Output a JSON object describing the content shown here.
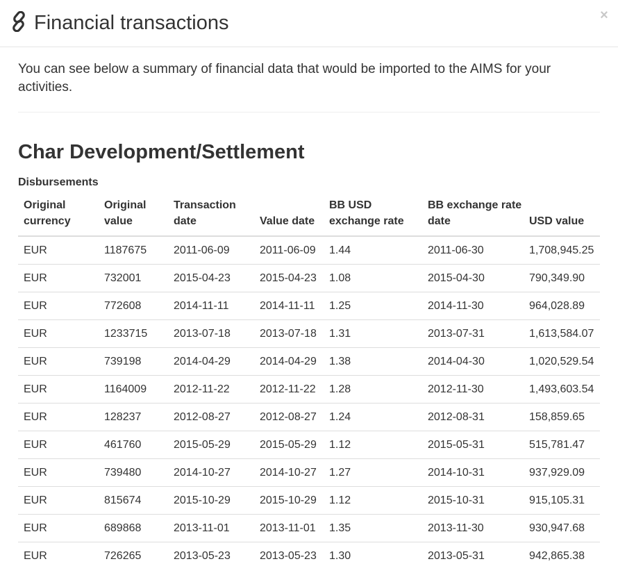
{
  "modal": {
    "title": "Financial transactions",
    "close_label": "×",
    "intro": "You can see below a summary of financial data that would be imported to the AIMS for your activities."
  },
  "project": {
    "title": "Char Development/Settlement",
    "section": "Disbursements",
    "columns": [
      "Original currency",
      "Original value",
      "Transaction date",
      "Value date",
      "BB USD exchange rate",
      "BB exchange rate date",
      "USD value"
    ],
    "rows": [
      [
        "EUR",
        "1187675",
        "2011-06-09",
        "2011-06-09",
        "1.44",
        "2011-06-30",
        "1,708,945.25"
      ],
      [
        "EUR",
        "732001",
        "2015-04-23",
        "2015-04-23",
        "1.08",
        "2015-04-30",
        "790,349.90"
      ],
      [
        "EUR",
        "772608",
        "2014-11-11",
        "2014-11-11",
        "1.25",
        "2014-11-30",
        "964,028.89"
      ],
      [
        "EUR",
        "1233715",
        "2013-07-18",
        "2013-07-18",
        "1.31",
        "2013-07-31",
        "1,613,584.07"
      ],
      [
        "EUR",
        "739198",
        "2014-04-29",
        "2014-04-29",
        "1.38",
        "2014-04-30",
        "1,020,529.54"
      ],
      [
        "EUR",
        "1164009",
        "2012-11-22",
        "2012-11-22",
        "1.28",
        "2012-11-30",
        "1,493,603.54"
      ],
      [
        "EUR",
        "128237",
        "2012-08-27",
        "2012-08-27",
        "1.24",
        "2012-08-31",
        "158,859.65"
      ],
      [
        "EUR",
        "461760",
        "2015-05-29",
        "2015-05-29",
        "1.12",
        "2015-05-31",
        "515,781.47"
      ],
      [
        "EUR",
        "739480",
        "2014-10-27",
        "2014-10-27",
        "1.27",
        "2014-10-31",
        "937,929.09"
      ],
      [
        "EUR",
        "815674",
        "2015-10-29",
        "2015-10-29",
        "1.12",
        "2015-10-31",
        "915,105.31"
      ],
      [
        "EUR",
        "689868",
        "2013-11-01",
        "2013-11-01",
        "1.35",
        "2013-11-30",
        "930,947.68"
      ],
      [
        "EUR",
        "726265",
        "2013-05-23",
        "2013-05-23",
        "1.30",
        "2013-05-31",
        "942,865.38"
      ]
    ]
  },
  "icons": {
    "header": "link-icon",
    "close": "close-icon"
  },
  "colors": {
    "text": "#333333",
    "divider": "#dddddd",
    "close": "#c8c8c8"
  }
}
